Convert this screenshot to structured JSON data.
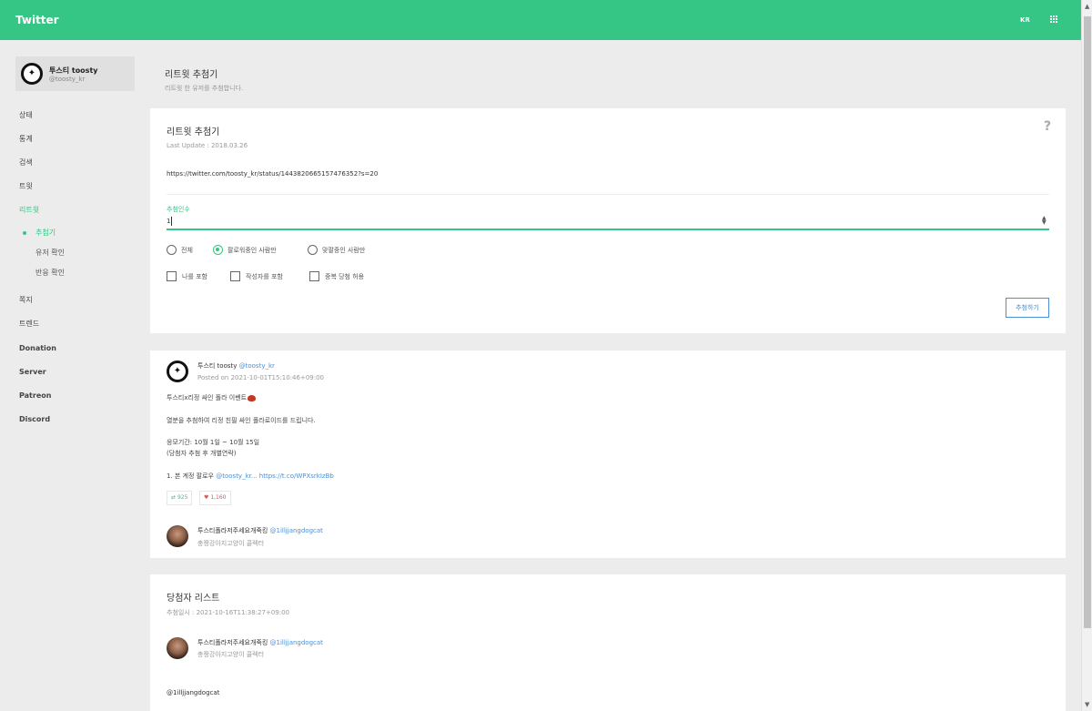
{
  "header": {
    "brand": "Twitter",
    "lang": "KR",
    "menu_icon": "grid-icon"
  },
  "profile": {
    "name": "투스티 toosty",
    "handle": "@toosty_kr"
  },
  "sidebar": {
    "items": [
      {
        "label": "상태"
      },
      {
        "label": "통계"
      },
      {
        "label": "검색"
      },
      {
        "label": "트윗"
      },
      {
        "label": "리트윗"
      }
    ],
    "sub_items": [
      {
        "label": "추첨기"
      },
      {
        "label": "유저 확인"
      },
      {
        "label": "반응 확인"
      }
    ],
    "items2": [
      {
        "label": "쪽지"
      },
      {
        "label": "트렌드"
      },
      {
        "label": "Donation"
      },
      {
        "label": "Server"
      },
      {
        "label": "Patreon"
      },
      {
        "label": "Discord"
      }
    ]
  },
  "page": {
    "title": "리트윗 추첨기",
    "desc": "리트윗 한 유저를 추첨합니다."
  },
  "form": {
    "title": "리트윗 추첨기",
    "last_update": "Last Update : 2018.03.26",
    "url": "https://twitter.com/toosty_kr/status/1443820665157476352?s=20",
    "count_label": "추첨인수",
    "count_value": "1",
    "radios": [
      {
        "label": "전체",
        "checked": false
      },
      {
        "label": "팔로워중인 사람만",
        "checked": true
      },
      {
        "label": "맞팔중인 사람만",
        "checked": false
      }
    ],
    "checks": [
      {
        "label": "나를 포함"
      },
      {
        "label": "작성자를 포함"
      },
      {
        "label": "중복 당첨 허용"
      }
    ],
    "submit": "추첨하기"
  },
  "tweet": {
    "author": "투스티 toosty",
    "handle": "@toosty_kr",
    "posted": "Posted on 2021-10-01T15:10:46+09:00",
    "line1": "투스티x리정 싸인 폴라 이벤트",
    "line2": "열분을 추첨하여 리정 친필 싸인 폴라로이드를 드립니다.",
    "line3": "응모기간: 10월 1일 ~ 10월 15일",
    "line4": "(당첨자 추첨 후 개별연락)",
    "line5_prefix": "1. 본 계정 팔로우 ",
    "line5_mention": "@toosty_kr...",
    "line5_link": "https://t.co/WPXsrkIzBb",
    "retweets": "925",
    "likes": "1,160",
    "retweeter": {
      "name": "투스티폴라저주세요개죽킹",
      "handle": "@1illjjangdogcat",
      "sub": "충짱강아지고양이 콜렉터"
    }
  },
  "winners": {
    "title": "당첨자 리스트",
    "date": "추첨일시 : 2021-10-16T11:38:27+09:00",
    "user": {
      "name": "투스티폴라저주세요개죽킹",
      "handle": "@1illjjangdogcat",
      "sub": "충짱강아지고양이 콜렉터"
    },
    "winner_handle": "@1illjjangdogcat"
  }
}
